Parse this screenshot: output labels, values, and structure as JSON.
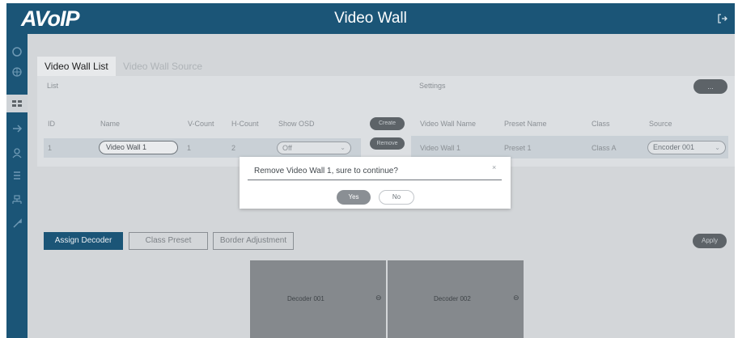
{
  "header": {
    "logo": "AVoIP",
    "title": "Video Wall"
  },
  "tabs": [
    "Video Wall List",
    "Video Wall Source"
  ],
  "list_section": {
    "label": "List",
    "columns": [
      "ID",
      "Name",
      "V-Count",
      "H-Count",
      "Show OSD"
    ],
    "row": {
      "id": "1",
      "name": "Video Wall 1",
      "v_count": "1",
      "h_count": "2",
      "show_osd": "Off"
    },
    "create_label": "Create",
    "remove_label": "Remove"
  },
  "settings_section": {
    "label": "Settings",
    "button_label": "...",
    "columns": [
      "Video Wall Name",
      "Preset Name",
      "Class",
      "Source"
    ],
    "row": {
      "video_wall_name": "Video Wall 1",
      "preset_name": "Preset 1",
      "class": "Class A",
      "source": "Encoder 001"
    }
  },
  "bottom_tabs": {
    "assign_decoder": "Assign Decoder",
    "class_preset": "Class Preset",
    "border_adjustment": "Border Adjustment",
    "apply": "Apply"
  },
  "decoders": [
    {
      "label": "Decoder 001",
      "icon": "remove-circle-icon"
    },
    {
      "label": "Decoder 002",
      "icon": "remove-circle-icon"
    }
  ],
  "dialog": {
    "message": "Remove Video Wall 1, sure to continue?",
    "close": "×",
    "yes": "Yes",
    "no": "No"
  },
  "colors": {
    "brand": "#1b5577",
    "panel": "#d3d6d9",
    "dialog_bg": "#ffffff"
  }
}
